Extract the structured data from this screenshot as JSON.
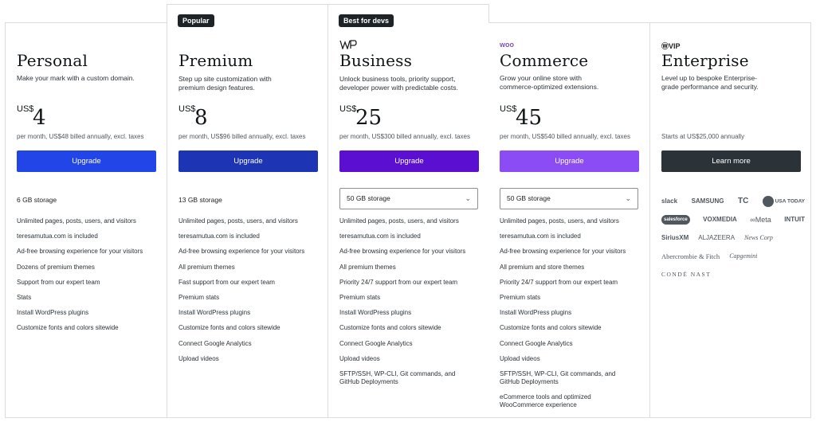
{
  "plans": [
    {
      "name": "Personal",
      "description": "Make your mark with a custom domain.",
      "currency": "US$",
      "price": "4",
      "billing": "per month, US$48 billed annually, excl. taxes",
      "button": "Upgrade",
      "button_color": "#2145e6",
      "storage": "6 GB storage",
      "features": [
        "Unlimited pages, posts, users, and visitors",
        "teresamutua.com is included",
        "Ad-free browsing experience for your visitors",
        "Dozens of premium themes",
        "Support from our expert team",
        "Stats",
        "Install WordPress plugins",
        "Customize fonts and colors sitewide"
      ]
    },
    {
      "name": "Premium",
      "badge": "Popular",
      "description": "Step up site customization with premium design features.",
      "currency": "US$",
      "price": "8",
      "billing": "per month, US$96 billed annually, excl. taxes",
      "button": "Upgrade",
      "button_color": "#1d35b4",
      "storage": "13 GB storage",
      "features": [
        "Unlimited pages, posts, users, and visitors",
        "teresamutua.com is included",
        "Ad-free browsing experience for your visitors",
        "All premium themes",
        "Fast support from our expert team",
        "Premium stats",
        "Install WordPress plugins",
        "Customize fonts and colors sitewide",
        "Connect Google Analytics",
        "Upload videos"
      ]
    },
    {
      "name": "Business",
      "badge": "Best for devs",
      "logo": "WP",
      "description": "Unlock business tools, priority support, developer power with predictable costs.",
      "currency": "US$",
      "price": "25",
      "billing": "per month, US$300 billed annually, excl. taxes",
      "button": "Upgrade",
      "button_color": "#5b0fd0",
      "storage": "50 GB storage",
      "features": [
        "Unlimited pages, posts, users, and visitors",
        "teresamutua.com is included",
        "Ad-free browsing experience for your visitors",
        "All premium themes",
        "Priority 24/7 support from our expert team",
        "Premium stats",
        "Install WordPress plugins",
        "Customize fonts and colors sitewide",
        "Connect Google Analytics",
        "Upload videos",
        "SFTP/SSH, WP-CLI, Git commands, and GitHub Deployments"
      ]
    },
    {
      "name": "Commerce",
      "logo": "woo",
      "description": "Grow your online store with commerce-optimized extensions.",
      "currency": "US$",
      "price": "45",
      "billing": "per month, US$540 billed annually, excl. taxes",
      "button": "Upgrade",
      "button_color": "#8b4cf5",
      "storage": "50 GB storage",
      "features": [
        "Unlimited pages, posts, users, and visitors",
        "teresamutua.com is included",
        "Ad-free browsing experience for your visitors",
        "All premium and store themes",
        "Priority 24/7 support from our expert team",
        "Premium stats",
        "Install WordPress plugins",
        "Customize fonts and colors sitewide",
        "Connect Google Analytics",
        "Upload videos",
        "SFTP/SSH, WP-CLI, Git commands, and GitHub Deployments",
        "eCommerce tools and optimized WooCommerce experience"
      ]
    },
    {
      "name": "Enterprise",
      "logo": "VIP",
      "description": "Level up to bespoke Enterprise-grade performance and security.",
      "starts": "Starts at US$25,000 annually",
      "button": "Learn more",
      "button_color": "#2c3338",
      "brands": [
        [
          "slack",
          "SAMSUNG",
          "TC",
          "USA TODAY"
        ],
        [
          "salesforce",
          "VOXMEDIA",
          "Meta",
          "INTUIT"
        ],
        [
          "SiriusXM",
          "ALJAZEERA",
          "News Corp"
        ],
        [
          "Abercrombie & Fitch",
          "Capgemini"
        ],
        [
          "CONDÉ NAST"
        ]
      ]
    }
  ]
}
